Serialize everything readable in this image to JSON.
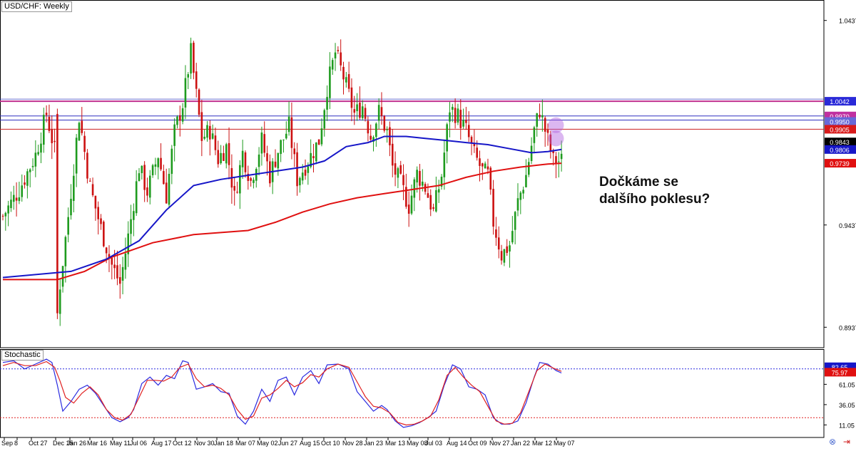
{
  "header": {
    "title": "USD/CHF: Weekly"
  },
  "oscillator": {
    "title": "Stochastic"
  },
  "annotation": {
    "line1": "Dočkáme se",
    "line2": "dalšího poklesu?"
  },
  "icons": {
    "sync": "link-sync-icon",
    "collapse": "collapse-arrow-icon"
  },
  "colors": {
    "bullish": "#1e9b1e",
    "bearish": "#cc1111",
    "ma_blue": "#1616c8",
    "ma_red": "#e01010",
    "resistance": "#c03090",
    "level_blue": "#3030c0",
    "level_red": "#cc2020",
    "highlight": "#b060e0",
    "stoch_k": "#2a2ae0",
    "stoch_d": "#e02020"
  },
  "chart_data": [
    {
      "type": "candlestick",
      "title": "USD/CHF: Weekly",
      "ylim": [
        0.8837,
        1.0537
      ],
      "y_ticks": [
        "1.0437",
        "0.9437",
        "0.8937"
      ],
      "x_tick_labels": [
        "Sep",
        "8",
        "Oct 27",
        "Dec 15",
        "Jan 26",
        "Mar 16",
        "May 11",
        "Jul 06",
        "Aug 17",
        "Oct 12",
        "Nov 30",
        "Jan 18",
        "Mar 07",
        "May 02",
        "Jun 27",
        "Aug 15",
        "Oct 10",
        "Nov 28",
        "Jan 23",
        "Mar 13",
        "May 08",
        "Jul 03",
        "Aug 14",
        "Oct 09",
        "Nov 27",
        "Jan 22",
        "Mar 12",
        "May 07"
      ],
      "levels": [
        {
          "value": 1.0042,
          "label": "1.0042",
          "kind": "resistance"
        },
        {
          "value": 0.997,
          "label": "0.9970",
          "kind": "blue"
        },
        {
          "value": 0.995,
          "label": "0.9950",
          "kind": "blue"
        },
        {
          "value": 0.9905,
          "label": "0.9905",
          "kind": "red"
        }
      ],
      "price_labels": [
        {
          "value": 0.9843,
          "label": "0.9843",
          "kind": "current"
        },
        {
          "value": 0.9806,
          "label": "0.9806",
          "kind": "ma_blue"
        },
        {
          "value": 0.9739,
          "label": "0.9739",
          "kind": "ma_red"
        }
      ],
      "highlights": [
        {
          "x": 0.9925,
          "kind": "circle-upper"
        },
        {
          "x": 0.986,
          "kind": "circle-lower"
        }
      ],
      "anchors": [
        [
          0,
          0.948
        ],
        [
          6,
          0.961
        ],
        [
          12,
          0.978
        ],
        [
          16,
          0.998
        ],
        [
          19,
          0.98
        ],
        [
          20,
          0.9
        ],
        [
          21,
          0.915
        ],
        [
          24,
          0.948
        ],
        [
          28,
          0.997
        ],
        [
          32,
          0.962
        ],
        [
          36,
          0.942
        ],
        [
          40,
          0.924
        ],
        [
          43,
          0.915
        ],
        [
          46,
          0.938
        ],
        [
          50,
          0.972
        ],
        [
          53,
          0.96
        ],
        [
          57,
          0.978
        ],
        [
          60,
          0.958
        ],
        [
          63,
          0.989
        ],
        [
          66,
          1.003
        ],
        [
          69,
          1.028
        ],
        [
          73,
          0.986
        ],
        [
          76,
          0.99
        ],
        [
          79,
          0.976
        ],
        [
          82,
          0.982
        ],
        [
          85,
          0.957
        ],
        [
          88,
          0.979
        ],
        [
          91,
          0.965
        ],
        [
          95,
          0.985
        ],
        [
          98,
          0.968
        ],
        [
          101,
          0.98
        ],
        [
          105,
          0.992
        ],
        [
          108,
          0.966
        ],
        [
          112,
          0.975
        ],
        [
          116,
          0.985
        ],
        [
          119,
          1.011
        ],
        [
          122,
          1.028
        ],
        [
          125,
          1.016
        ],
        [
          129,
          0.998
        ],
        [
          132,
          1.002
        ],
        [
          135,
          0.987
        ],
        [
          138,
          0.999
        ],
        [
          141,
          0.989
        ],
        [
          143,
          0.972
        ],
        [
          146,
          0.964
        ],
        [
          149,
          0.953
        ],
        [
          152,
          0.969
        ],
        [
          155,
          0.962
        ],
        [
          158,
          0.95
        ],
        [
          161,
          0.968
        ],
        [
          164,
          1.001
        ],
        [
          167,
          0.997
        ],
        [
          170,
          0.99
        ],
        [
          173,
          0.978
        ],
        [
          176,
          0.97
        ],
        [
          178,
          0.968
        ],
        [
          180,
          0.945
        ],
        [
          183,
          0.929
        ],
        [
          186,
          0.934
        ],
        [
          189,
          0.955
        ],
        [
          192,
          0.968
        ],
        [
          195,
          0.99
        ],
        [
          197,
          1.0
        ],
        [
          200,
          0.985
        ],
        [
          202,
          0.975
        ],
        [
          205,
          0.975
        ]
      ],
      "ma_blue": [
        [
          0,
          0.918
        ],
        [
          25,
          0.921
        ],
        [
          38,
          0.927
        ],
        [
          50,
          0.936
        ],
        [
          60,
          0.951
        ],
        [
          70,
          0.963
        ],
        [
          80,
          0.966
        ],
        [
          90,
          0.968
        ],
        [
          100,
          0.97
        ],
        [
          110,
          0.972
        ],
        [
          118,
          0.975
        ],
        [
          126,
          0.982
        ],
        [
          134,
          0.984
        ],
        [
          140,
          0.987
        ],
        [
          148,
          0.987
        ],
        [
          155,
          0.986
        ],
        [
          163,
          0.985
        ],
        [
          170,
          0.984
        ],
        [
          178,
          0.983
        ],
        [
          186,
          0.981
        ],
        [
          194,
          0.979
        ],
        [
          200,
          0.9796
        ],
        [
          205,
          0.9806
        ]
      ],
      "ma_red": [
        [
          0,
          0.917
        ],
        [
          20,
          0.917
        ],
        [
          30,
          0.921
        ],
        [
          40,
          0.928
        ],
        [
          55,
          0.935
        ],
        [
          70,
          0.939
        ],
        [
          80,
          0.94
        ],
        [
          90,
          0.941
        ],
        [
          100,
          0.945
        ],
        [
          110,
          0.95
        ],
        [
          120,
          0.954
        ],
        [
          130,
          0.957
        ],
        [
          140,
          0.959
        ],
        [
          150,
          0.961
        ],
        [
          160,
          0.963
        ],
        [
          170,
          0.967
        ],
        [
          180,
          0.97
        ],
        [
          190,
          0.972
        ],
        [
          200,
          0.9735
        ],
        [
          205,
          0.9739
        ]
      ]
    },
    {
      "type": "line",
      "title": "Stochastic",
      "ylim": [
        0,
        100
      ],
      "y_ticks": [
        "61.05",
        "36.05",
        "11.05"
      ],
      "levels": [
        {
          "value": 80,
          "kind": "overbought"
        },
        {
          "value": 20,
          "kind": "oversold"
        }
      ],
      "price_labels": [
        {
          "value": 82.65,
          "label": "82.65",
          "kind": "k"
        },
        {
          "value": 75.97,
          "label": "75.97",
          "kind": "d"
        }
      ],
      "series": [
        {
          "key": "k",
          "values": [
            [
              0,
              88
            ],
            [
              4,
              90
            ],
            [
              8,
              80
            ],
            [
              12,
              86
            ],
            [
              16,
              92
            ],
            [
              18,
              88
            ],
            [
              20,
              60
            ],
            [
              22,
              28
            ],
            [
              25,
              40
            ],
            [
              28,
              55
            ],
            [
              31,
              60
            ],
            [
              34,
              50
            ],
            [
              37,
              35
            ],
            [
              40,
              20
            ],
            [
              43,
              15
            ],
            [
              46,
              20
            ],
            [
              48,
              30
            ],
            [
              51,
              62
            ],
            [
              54,
              70
            ],
            [
              57,
              60
            ],
            [
              60,
              72
            ],
            [
              63,
              68
            ],
            [
              66,
              90
            ],
            [
              68,
              88
            ],
            [
              71,
              55
            ],
            [
              74,
              58
            ],
            [
              77,
              62
            ],
            [
              80,
              52
            ],
            [
              83,
              50
            ],
            [
              86,
              22
            ],
            [
              89,
              12
            ],
            [
              92,
              28
            ],
            [
              95,
              55
            ],
            [
              98,
              40
            ],
            [
              101,
              66
            ],
            [
              104,
              70
            ],
            [
              107,
              48
            ],
            [
              110,
              70
            ],
            [
              113,
              78
            ],
            [
              116,
              62
            ],
            [
              119,
              85
            ],
            [
              123,
              86
            ],
            [
              127,
              80
            ],
            [
              130,
              52
            ],
            [
              133,
              40
            ],
            [
              136,
              28
            ],
            [
              139,
              35
            ],
            [
              141,
              30
            ],
            [
              144,
              16
            ],
            [
              147,
              8
            ],
            [
              150,
              10
            ],
            [
              153,
              14
            ],
            [
              156,
              20
            ],
            [
              159,
              28
            ],
            [
              162,
              60
            ],
            [
              165,
              85
            ],
            [
              168,
              80
            ],
            [
              171,
              58
            ],
            [
              174,
              55
            ],
            [
              177,
              48
            ],
            [
              180,
              20
            ],
            [
              183,
              12
            ],
            [
              186,
              12
            ],
            [
              189,
              16
            ],
            [
              192,
              38
            ],
            [
              195,
              70
            ],
            [
              197,
              88
            ],
            [
              200,
              86
            ],
            [
              203,
              78
            ],
            [
              205,
              75
            ]
          ]
        },
        {
          "key": "d",
          "values": [
            [
              0,
              84
            ],
            [
              4,
              88
            ],
            [
              8,
              84
            ],
            [
              12,
              84
            ],
            [
              16,
              89
            ],
            [
              19,
              82
            ],
            [
              21,
              65
            ],
            [
              23,
              45
            ],
            [
              26,
              38
            ],
            [
              29,
              50
            ],
            [
              32,
              58
            ],
            [
              35,
              48
            ],
            [
              38,
              30
            ],
            [
              41,
              20
            ],
            [
              44,
              17
            ],
            [
              47,
              24
            ],
            [
              50,
              45
            ],
            [
              53,
              66
            ],
            [
              56,
              66
            ],
            [
              59,
              65
            ],
            [
              62,
              70
            ],
            [
              65,
              82
            ],
            [
              68,
              86
            ],
            [
              71,
              68
            ],
            [
              74,
              58
            ],
            [
              77,
              60
            ],
            [
              80,
              56
            ],
            [
              83,
              48
            ],
            [
              86,
              30
            ],
            [
              89,
              18
            ],
            [
              92,
              22
            ],
            [
              95,
              44
            ],
            [
              98,
              48
            ],
            [
              101,
              56
            ],
            [
              104,
              66
            ],
            [
              107,
              58
            ],
            [
              110,
              63
            ],
            [
              113,
              73
            ],
            [
              116,
              70
            ],
            [
              119,
              80
            ],
            [
              123,
              86
            ],
            [
              127,
              82
            ],
            [
              130,
              64
            ],
            [
              133,
              46
            ],
            [
              136,
              34
            ],
            [
              139,
              32
            ],
            [
              142,
              26
            ],
            [
              145,
              14
            ],
            [
              148,
              11
            ],
            [
              151,
              12
            ],
            [
              154,
              16
            ],
            [
              157,
              22
            ],
            [
              160,
              42
            ],
            [
              163,
              72
            ],
            [
              166,
              82
            ],
            [
              169,
              70
            ],
            [
              172,
              60
            ],
            [
              175,
              52
            ],
            [
              178,
              34
            ],
            [
              181,
              16
            ],
            [
              184,
              12
            ],
            [
              187,
              13
            ],
            [
              190,
              26
            ],
            [
              193,
              52
            ],
            [
              196,
              78
            ],
            [
              199,
              86
            ],
            [
              202,
              81
            ],
            [
              205,
              77
            ]
          ]
        }
      ]
    }
  ]
}
